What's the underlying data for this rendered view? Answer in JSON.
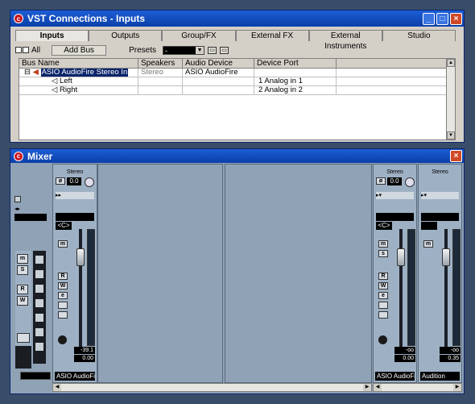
{
  "vst": {
    "title": "VST Connections - Inputs",
    "tabs": [
      "Inputs",
      "Outputs",
      "Group/FX",
      "External FX",
      "External Instruments",
      "Studio"
    ],
    "all_label": "All",
    "add_bus_label": "Add Bus",
    "presets_label": "Presets",
    "presets_value": "-",
    "columns": [
      "Bus Name",
      "Speakers",
      "Audio Device",
      "Device Port"
    ],
    "rows": [
      {
        "name": "ASIO AudioFire Stereo In",
        "speakers": "Stereo",
        "device": "ASIO AudioFire",
        "port": ""
      },
      {
        "name": "Left",
        "speakers": "",
        "device": "",
        "port": "1 Analog in 1"
      },
      {
        "name": "Right",
        "speakers": "",
        "device": "",
        "port": "2 Analog in 2"
      }
    ]
  },
  "mixer": {
    "title": "Mixer",
    "strip_left": {
      "format": "Stereo",
      "pan_value": "0.0",
      "pan_label": "<C>",
      "level_readout": "-39.1",
      "volume_readout": "0.00",
      "name": "ASIO AudioFire"
    },
    "strip_right1": {
      "format": "Stereo",
      "pan_value": "0.0",
      "pan_label": "<C>",
      "level_readout": "-oo",
      "volume_readout": "0.00",
      "name": "ASIO AudioFir"
    },
    "strip_right2": {
      "format": "Stereo",
      "level_readout": "-oo",
      "volume_readout": "0.35",
      "name": "Audition"
    },
    "buttons": {
      "m": "m",
      "s": "s",
      "r": "R",
      "w": "W",
      "e": "e"
    },
    "common": {
      "m": "m",
      "s": "S",
      "r": "R",
      "w": "W"
    }
  }
}
